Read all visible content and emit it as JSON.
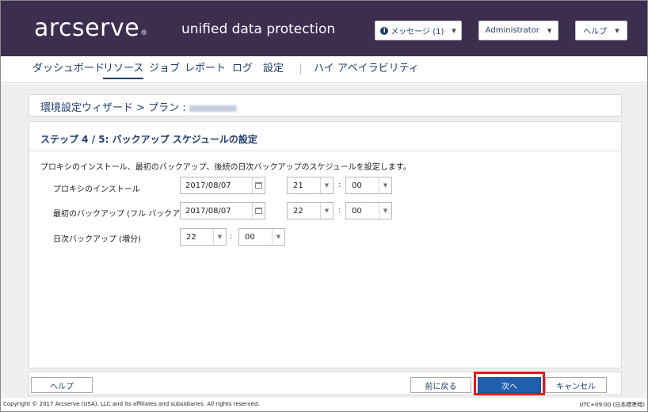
{
  "header": {
    "logo": "arcserve",
    "logo_mark": "®",
    "product": "unified data protection",
    "messages_label": "メッセージ (1)",
    "user_label": "Administrator",
    "help_label": "ヘルプ"
  },
  "nav": {
    "items": [
      {
        "label": "ダッシュボード"
      },
      {
        "label": "リソース"
      },
      {
        "label": "ジョブ"
      },
      {
        "label": "レポート"
      },
      {
        "label": "ログ"
      },
      {
        "label": "設定"
      },
      {
        "label": "ハイ アベイラビリティ"
      }
    ],
    "active": "リソース"
  },
  "wizard": {
    "title": "環境設定ウィザード > プラン :",
    "step_title": "ステップ 4 / 5: バックアップ スケジュールの設定",
    "description": "プロキシのインストール、最初のバックアップ、後続の日次バックアップのスケジュールを設定します。",
    "rows": [
      {
        "label": "プロキシのインストール",
        "date": "2017/08/07",
        "hour": "21",
        "minute": "00"
      },
      {
        "label": "最初のバックアップ (フル バックアップ)",
        "date": "2017/08/07",
        "hour": "22",
        "minute": "00"
      },
      {
        "label": "日次バックアップ (増分)",
        "hour": "22",
        "minute": "00"
      }
    ],
    "colon": ":"
  },
  "footer": {
    "help": "ヘルプ",
    "back": "前に戻る",
    "next": "次へ",
    "cancel": "キャンセル"
  },
  "status": {
    "copyright": "Copyright © 2017 Arcserve (USA), LLC and its affiliates and subsidiaries. All rights reserved.",
    "timezone": "UTC+09:00 (日本標準時)"
  },
  "colors": {
    "header_bg": "#3b2e4f",
    "accent": "#1f3c6e",
    "primary_button": "#1f5fae",
    "highlight": "#e01b1b"
  }
}
